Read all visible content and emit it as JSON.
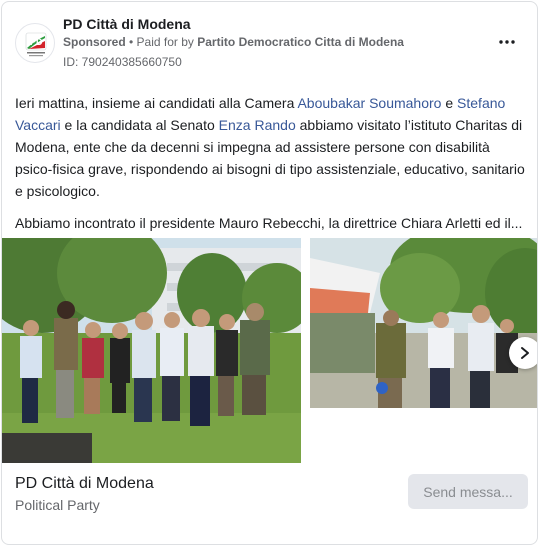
{
  "header": {
    "page_name": "PD Città di Modena",
    "sponsored": "Sponsored",
    "separator": " • ",
    "paid_for_prefix": "Paid for by ",
    "payer": "Partito Democratico Citta di Modena",
    "ad_id": "ID: 790240385660750",
    "more_icon": "more-horizontal-icon",
    "logo_text": "PD"
  },
  "body": {
    "p1_a": "Ieri mattina, insieme ai candidati alla Camera ",
    "link1": "Aboubakar Soumahoro",
    "p1_b": " e ",
    "link2": "Stefano Vaccari",
    "p1_c": " e la candidata al Senato ",
    "link3": "Enza Rando",
    "p1_d": " abbiamo visitato l’istituto Charitas di Modena, ente che da decenni si impegna ad assistere persone con disabilità psico-fisica grave, rispondendo ai bisogni di tipo assistenziale, educativo, sanitario e psicologico.",
    "p2": "Abbiamo incontrato il presidente Mauro Rebecchi, la direttrice Chiara Arletti ed il..."
  },
  "carousel": {
    "next_icon": "chevron-right-icon"
  },
  "footer": {
    "page_name": "PD Città di Modena",
    "category": "Political Party",
    "send_label": "Send messa..."
  },
  "colors": {
    "link": "#385898",
    "secondary_text": "#65676b",
    "button_bg": "#e4e6eb",
    "brand_green": "#2e9e3f",
    "brand_red": "#d2232a"
  }
}
